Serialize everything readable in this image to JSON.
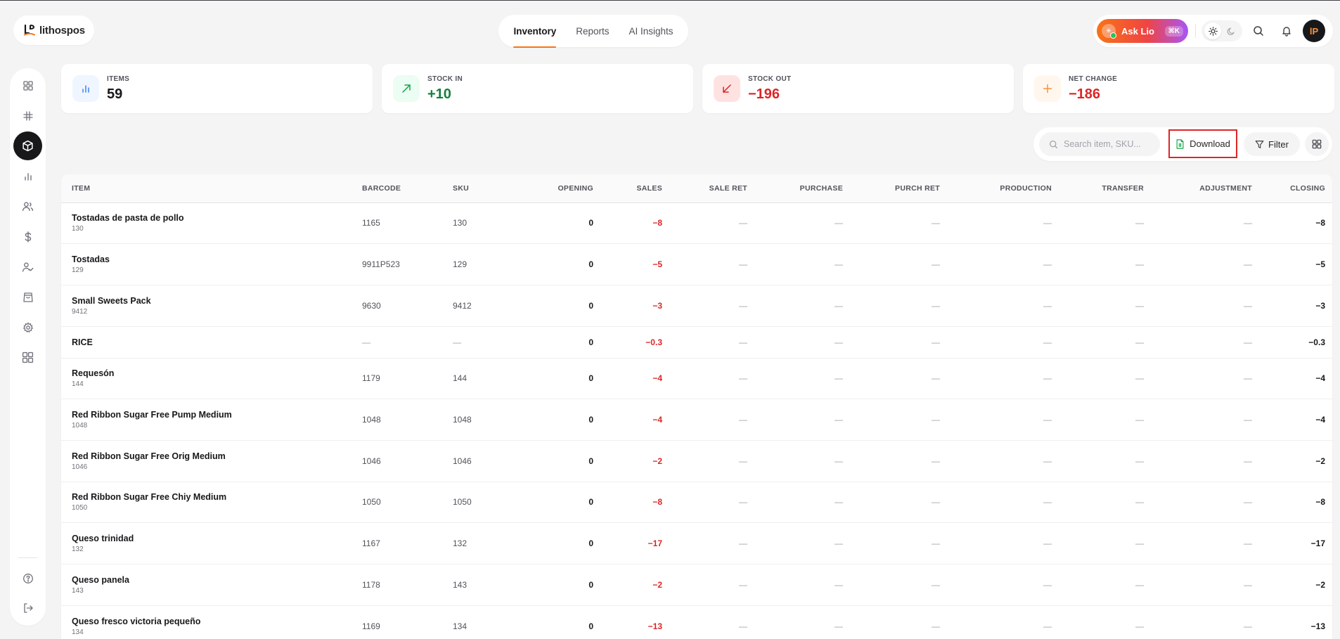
{
  "brand": {
    "name": "lithospos"
  },
  "nav_tabs": [
    {
      "label": "Inventory",
      "active": true
    },
    {
      "label": "Reports",
      "active": false
    },
    {
      "label": "AI Insights",
      "active": false
    }
  ],
  "ask_lio": {
    "label": "Ask Lio",
    "shortcut": "⌘K"
  },
  "header_icons": [
    "sun-icon",
    "moon-icon",
    "search-icon",
    "bell-icon"
  ],
  "avatar": {
    "initials": "lP"
  },
  "colors": {
    "accent": "#f97316",
    "positive": "#15803d",
    "negative": "#dc2626"
  },
  "stats": [
    {
      "label": "ITEMS",
      "value": "59",
      "icon": "bar-chart-icon",
      "color": "#18181b"
    },
    {
      "label": "STOCK IN",
      "value": "+10",
      "icon": "arrow-up-right-icon",
      "color": "#15803d"
    },
    {
      "label": "STOCK OUT",
      "value": "−196",
      "icon": "arrow-down-left-icon",
      "color": "#dc2626"
    },
    {
      "label": "NET CHANGE",
      "value": "−186",
      "icon": "plus-icon",
      "color": "#dc2626"
    }
  ],
  "toolbar": {
    "search_placeholder": "Search item, SKU...",
    "download_label": "Download",
    "filter_label": "Filter"
  },
  "table": {
    "columns": [
      "ITEM",
      "BARCODE",
      "SKU",
      "OPENING",
      "SALES",
      "SALE RET",
      "PURCHASE",
      "PURCH RET",
      "PRODUCTION",
      "TRANSFER",
      "ADJUSTMENT",
      "CLOSING"
    ],
    "rows": [
      {
        "name": "Tostadas de pasta de pollo",
        "sub": "130",
        "barcode": "1165",
        "sku": "130",
        "opening": "0",
        "sales": "−8",
        "sale_ret": "—",
        "purchase": "—",
        "purch_ret": "—",
        "production": "—",
        "transfer": "—",
        "adjustment": "—",
        "closing": "−8"
      },
      {
        "name": "Tostadas",
        "sub": "129",
        "barcode": "9911P523",
        "sku": "129",
        "opening": "0",
        "sales": "−5",
        "sale_ret": "—",
        "purchase": "—",
        "purch_ret": "—",
        "production": "—",
        "transfer": "—",
        "adjustment": "—",
        "closing": "−5"
      },
      {
        "name": "Small Sweets Pack",
        "sub": "9412",
        "barcode": "9630",
        "sku": "9412",
        "opening": "0",
        "sales": "−3",
        "sale_ret": "—",
        "purchase": "—",
        "purch_ret": "—",
        "production": "—",
        "transfer": "—",
        "adjustment": "—",
        "closing": "−3"
      },
      {
        "name": "RICE",
        "sub": "",
        "barcode": "—",
        "sku": "—",
        "opening": "0",
        "sales": "−0.3",
        "sale_ret": "—",
        "purchase": "—",
        "purch_ret": "—",
        "production": "—",
        "transfer": "—",
        "adjustment": "—",
        "closing": "−0.3"
      },
      {
        "name": "Requesón",
        "sub": "144",
        "barcode": "1179",
        "sku": "144",
        "opening": "0",
        "sales": "−4",
        "sale_ret": "—",
        "purchase": "—",
        "purch_ret": "—",
        "production": "—",
        "transfer": "—",
        "adjustment": "—",
        "closing": "−4"
      },
      {
        "name": "Red Ribbon Sugar Free Pump Medium",
        "sub": "1048",
        "barcode": "1048",
        "sku": "1048",
        "opening": "0",
        "sales": "−4",
        "sale_ret": "—",
        "purchase": "—",
        "purch_ret": "—",
        "production": "—",
        "transfer": "—",
        "adjustment": "—",
        "closing": "−4"
      },
      {
        "name": "Red Ribbon Sugar Free Orig Medium",
        "sub": "1046",
        "barcode": "1046",
        "sku": "1046",
        "opening": "0",
        "sales": "−2",
        "sale_ret": "—",
        "purchase": "—",
        "purch_ret": "—",
        "production": "—",
        "transfer": "—",
        "adjustment": "—",
        "closing": "−2"
      },
      {
        "name": "Red Ribbon Sugar Free Chiy Medium",
        "sub": "1050",
        "barcode": "1050",
        "sku": "1050",
        "opening": "0",
        "sales": "−8",
        "sale_ret": "—",
        "purchase": "—",
        "purch_ret": "—",
        "production": "—",
        "transfer": "—",
        "adjustment": "—",
        "closing": "−8"
      },
      {
        "name": "Queso trinidad",
        "sub": "132",
        "barcode": "1167",
        "sku": "132",
        "opening": "0",
        "sales": "−17",
        "sale_ret": "—",
        "purchase": "—",
        "purch_ret": "—",
        "production": "—",
        "transfer": "—",
        "adjustment": "—",
        "closing": "−17"
      },
      {
        "name": "Queso panela",
        "sub": "143",
        "barcode": "1178",
        "sku": "143",
        "opening": "0",
        "sales": "−2",
        "sale_ret": "—",
        "purchase": "—",
        "purch_ret": "—",
        "production": "—",
        "transfer": "—",
        "adjustment": "—",
        "closing": "−2"
      },
      {
        "name": "Queso fresco victoria pequeño",
        "sub": "134",
        "barcode": "1169",
        "sku": "134",
        "opening": "0",
        "sales": "−13",
        "sale_ret": "—",
        "purchase": "—",
        "purch_ret": "—",
        "production": "—",
        "transfer": "—",
        "adjustment": "—",
        "closing": "−13"
      }
    ]
  },
  "sidebar": {
    "items": [
      {
        "icon": "dashboard-grid-icon",
        "active": false
      },
      {
        "icon": "pos-terminal-icon",
        "active": false
      },
      {
        "icon": "inventory-box-icon",
        "active": true
      },
      {
        "icon": "reports-bar-icon",
        "active": false
      },
      {
        "icon": "customers-icon",
        "active": false
      },
      {
        "icon": "dollar-icon",
        "active": false
      },
      {
        "icon": "staff-check-icon",
        "active": false
      },
      {
        "icon": "shopping-bag-icon",
        "active": false
      },
      {
        "icon": "settings-gear-icon",
        "active": false
      },
      {
        "icon": "apps-grid-icon",
        "active": false
      }
    ],
    "bottom": [
      {
        "icon": "help-icon"
      },
      {
        "icon": "logout-icon"
      }
    ]
  }
}
